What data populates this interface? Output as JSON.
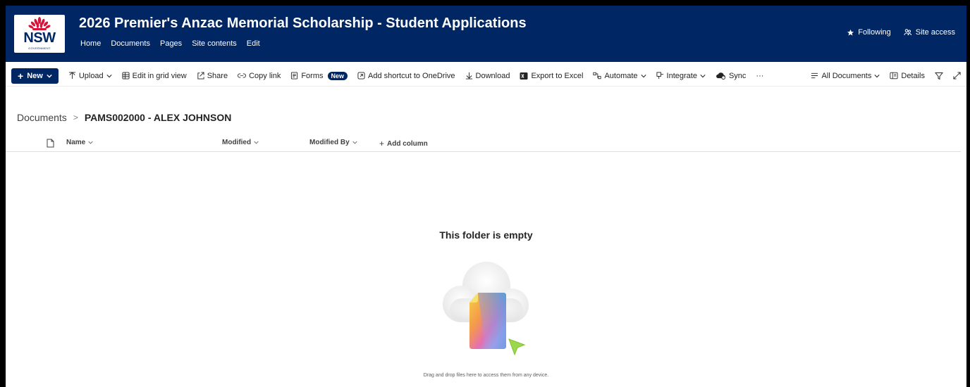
{
  "header": {
    "logo_text": "NSW",
    "logo_subtext": "GOVERNMENT",
    "site_title": "2026 Premier's Anzac Memorial Scholarship - Student Applications",
    "nav": [
      "Home",
      "Documents",
      "Pages",
      "Site contents",
      "Edit"
    ],
    "following_label": "Following",
    "site_access_label": "Site access"
  },
  "commandbar": {
    "new_label": "New",
    "upload_label": "Upload",
    "edit_grid_label": "Edit in grid view",
    "share_label": "Share",
    "copy_link_label": "Copy link",
    "forms_label": "Forms",
    "forms_badge": "New",
    "shortcut_label": "Add shortcut to OneDrive",
    "download_label": "Download",
    "export_label": "Export to Excel",
    "automate_label": "Automate",
    "integrate_label": "Integrate",
    "sync_label": "Sync",
    "more_label": "···",
    "view_label": "All Documents",
    "details_label": "Details"
  },
  "breadcrumb": {
    "root": "Documents",
    "separator": ">",
    "current": "PAMS002000 - ALEX JOHNSON"
  },
  "columns": {
    "name": "Name",
    "modified": "Modified",
    "modified_by": "Modified By",
    "add_column": "Add column"
  },
  "empty_state": {
    "title": "This folder is empty",
    "hint": "Drag and drop files here to access them from any device."
  },
  "colors": {
    "brand_navy": "#002664",
    "waratah_red": "#d7153a"
  }
}
